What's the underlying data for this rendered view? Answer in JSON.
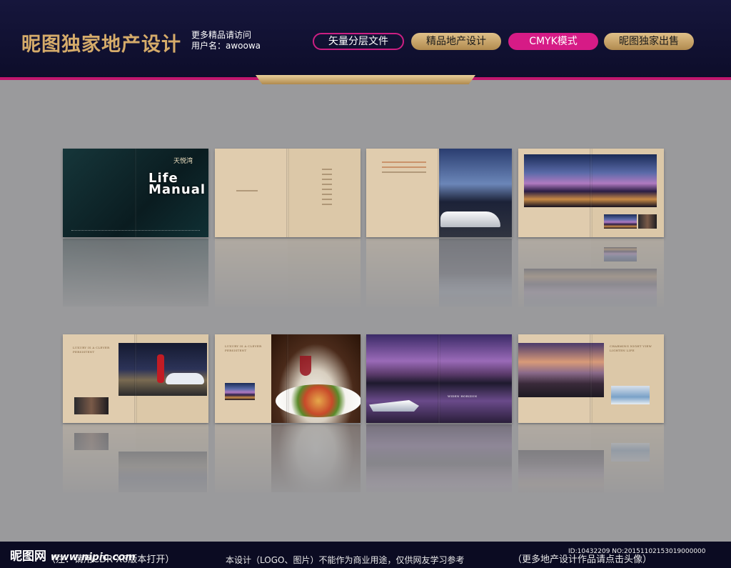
{
  "header": {
    "brand": "昵图独家地产设计",
    "subtitle_line1": "更多精品请访问",
    "subtitle_line2": "用户名：awoowa",
    "tags": [
      "矢量分层文件",
      "精品地产设计",
      "CMYK模式",
      "昵图独家出售"
    ]
  },
  "showcase": {
    "cover_logo": "天悦湾",
    "cover_title_line1": "Life",
    "cover_title_line2": "Manual",
    "spread5_title": "LUXURY IS A CLEVER PERSISTENT",
    "spread6_title": "LUXURY IS A CLEVER PERSISTENT",
    "spread7_title": "WIDEN HORIZON",
    "spread8_title": "CHARMING NIGHT VIEW LIGHTEN LIFE"
  },
  "footer": {
    "logo": "昵图网",
    "url": "www.nipic.com",
    "note1": "（注：请用CDR X6版本打开）",
    "note2": "本设计（LOGO、图片）不能作为商业用途，仅供网友学习参考",
    "note3": "（更多地产设计作品请点击头像）",
    "id_line": "ID:10432209 NO:20151102153019000000"
  },
  "colors": {
    "header_bg": "#0d0d2a",
    "accent_pink": "#d61b86",
    "accent_gold": "#d5ab6a",
    "backdrop_gray": "#9a9a9c",
    "page_beige": "#e0ccae"
  }
}
